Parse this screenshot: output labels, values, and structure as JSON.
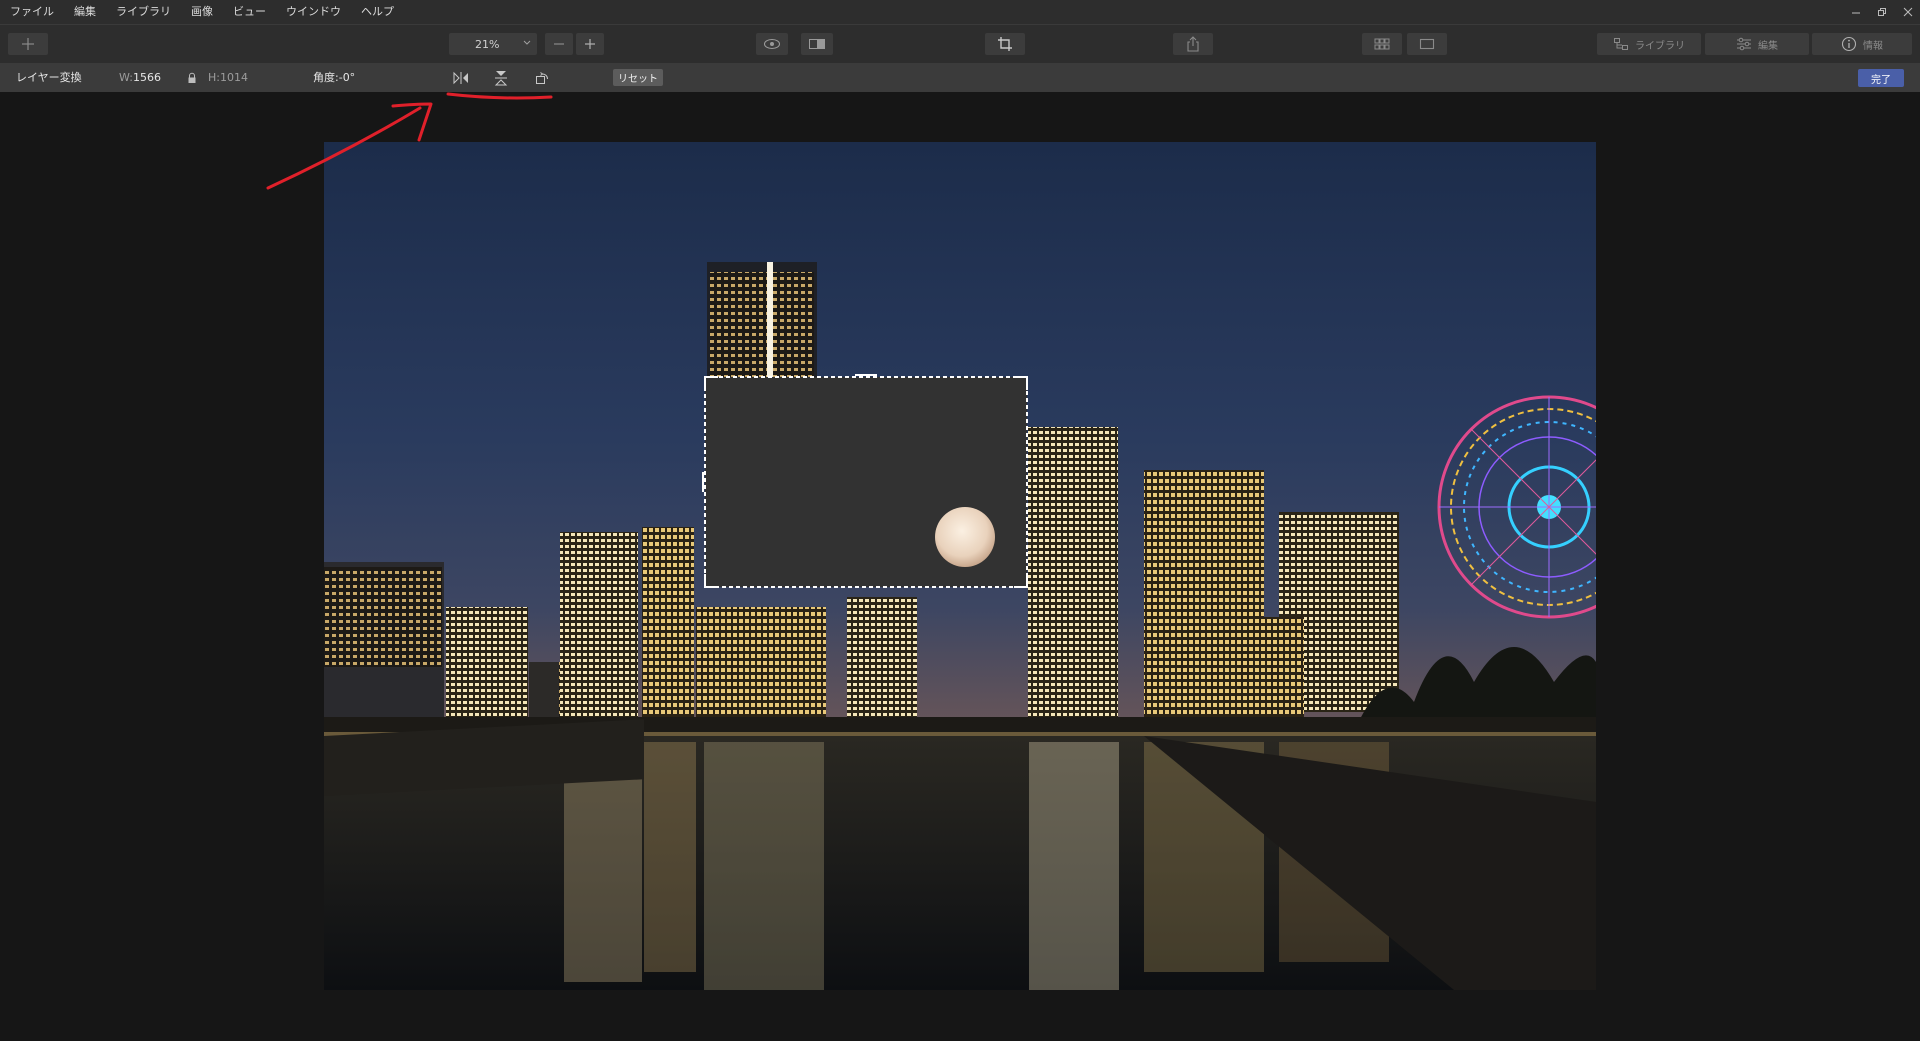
{
  "menu": [
    "ファイル",
    "編集",
    "ライブラリ",
    "画像",
    "ビュー",
    "ウインドウ",
    "ヘルプ"
  ],
  "window_controls": [
    "minimize-icon",
    "restore-icon",
    "close-icon"
  ],
  "toolbar": {
    "zoom": "21%",
    "right": [
      {
        "label": "ライブラリ",
        "icon": "library-icon"
      },
      {
        "label": "編集",
        "icon": "sliders-icon"
      },
      {
        "label": "情報",
        "icon": "info-icon"
      }
    ]
  },
  "options": {
    "mode": "レイヤー変換",
    "width_label": "W:",
    "width_value": "1566",
    "height_label": "H:",
    "height_value": "1014",
    "angle_label": "角度:",
    "angle_value": "-0°",
    "reset": "リセット",
    "done": "完了"
  },
  "colors": {
    "accent": "#4a5fa8",
    "annotation": "#e0202a",
    "chrome": "#2d2d2d",
    "optbar": "#3b3b3b"
  }
}
